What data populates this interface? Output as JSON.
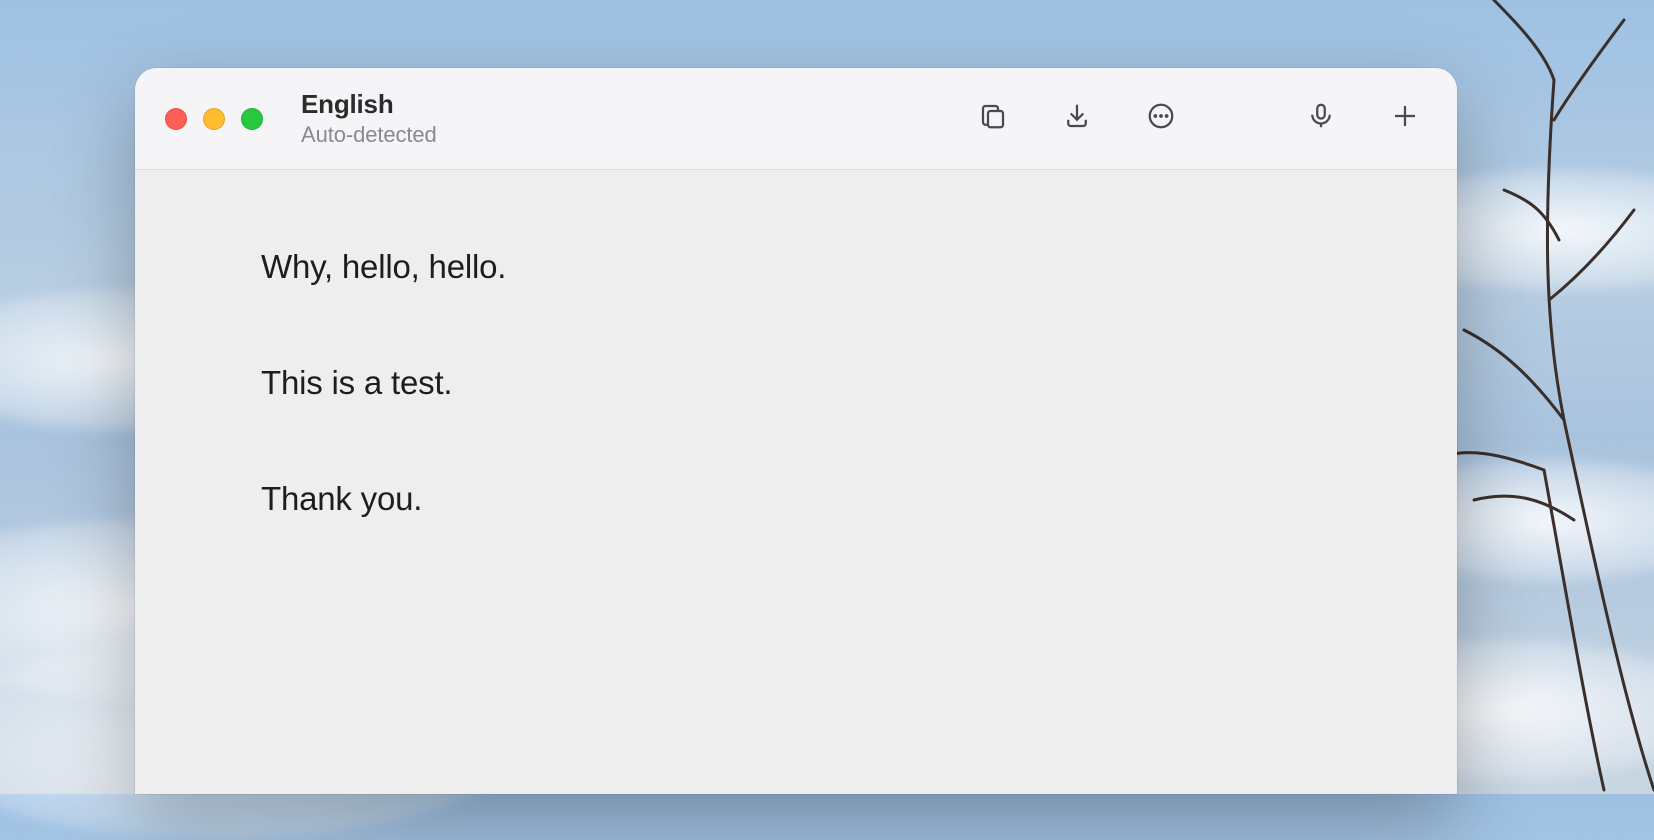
{
  "header": {
    "language": "English",
    "subtitle": "Auto-detected"
  },
  "transcript": {
    "lines": [
      "Why, hello, hello.",
      "This is a test.",
      "Thank you."
    ]
  }
}
